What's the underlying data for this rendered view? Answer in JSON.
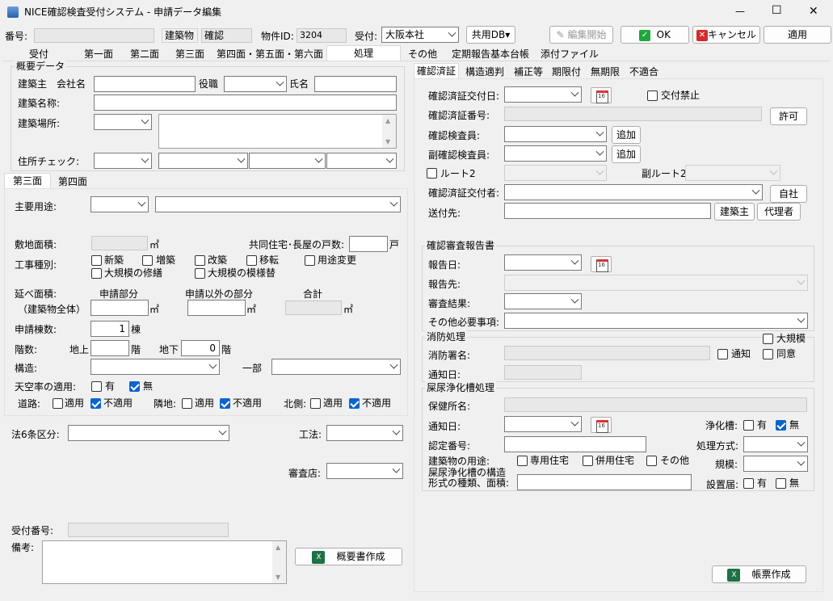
{
  "window": {
    "title": "NICE確認検査受付システム - 申請データ編集",
    "min": "—",
    "max": "☐",
    "close": "✕"
  },
  "top": {
    "bango_label": "番号:",
    "building_type": "建築物",
    "kakunin": "確認",
    "bukken_label": "物件ID:",
    "bukken_id": "3204",
    "uketsuke_label": "受付:",
    "uketsuke_value": "大阪本社",
    "kyoyodb": "共用DB▾",
    "edit_start": "編集開始",
    "ok": "OK",
    "cancel": "キャンセル",
    "apply": "適用"
  },
  "main_tabs": [
    "受付",
    "第一面",
    "第二面",
    "第三面",
    "第四面・第五面・第六面",
    "処理",
    "その他",
    "定期報告基本台帳",
    "添付ファイル"
  ],
  "gaiyo": {
    "title": "概要データ",
    "kenchikunushi": "建築主",
    "kaishamei": "会社名",
    "yakushoku": "役職",
    "shimei": "氏名",
    "kenchiku_meisho": "建築名称:",
    "kenchiku_basho": "建築場所:",
    "jusho_check": "住所チェック:"
  },
  "sub_tabs": [
    "第三面",
    "第四面"
  ],
  "daisanmen": {
    "shuyo_yoto": "主要用途:",
    "shikichi": "敷地面積:",
    "m2": "㎡",
    "kyodo": "共同住宅･長屋の戸数:",
    "ko": "戸",
    "koji_label": "工事種別:",
    "koji": [
      "新築",
      "増築",
      "改築",
      "移転",
      "用途変更",
      "大規模の修繕",
      "大規模の模様替"
    ],
    "nobe": "延べ面積:",
    "zentai": "（建築物全体）",
    "shinsei": "申請部分",
    "shinsei_igai": "申請以外の部分",
    "gokei": "合計",
    "tosu_label": "申請棟数:",
    "tosu": "1",
    "to": "棟",
    "kaisu": "階数:",
    "chijo": "地上",
    "kai": "階",
    "chika": "地下",
    "chika_val": "0",
    "kozo": "構造:",
    "ichibu": "一部",
    "tenku": "天空率の適用:",
    "ari": "有",
    "nashi": "無",
    "doro": "道路:",
    "rinchi": "隣地:",
    "kitagawa": "北側:",
    "tekiyo": "適用",
    "futekiyo": "不適用"
  },
  "lower": {
    "ho6jo": "法6条区分:",
    "koho": "工法:",
    "shinsa": "審査店:",
    "uketsuke_bango": "受付番号:",
    "biko": "備考:",
    "gaiyo_btn": "概要書作成"
  },
  "right_tabs": [
    "確認済証",
    "構造適判",
    "補正等",
    "期限付",
    "無期限",
    "不適合"
  ],
  "kakunin": {
    "kofubi": "確認済証交付日:",
    "kofu_kinshi": "交付禁止",
    "sumi_bango": "確認済証番号:",
    "kyoka": "許可",
    "kensain": "確認検査員:",
    "tsuika": "追加",
    "fuku_kensain": "副確認検査員:",
    "route2": "ルート2",
    "fuku_route2": "副ルート2",
    "kofusha": "確認済証交付者:",
    "jisha": "自社",
    "sofusaki": "送付先:",
    "kenchikunushi_btn": "建築主",
    "dairinin": "代理者"
  },
  "shinsa_hokoku": {
    "title": "確認審査報告書",
    "hokokubi": "報告日:",
    "hokokusaki": "報告先:",
    "kekka": "審査結果:",
    "sonota": "その他必要事項:"
  },
  "shobo": {
    "title": "消防処理",
    "daikibo": "大規模",
    "shobosho": "消防署名:",
    "tsuchi": "通知",
    "doi": "同意",
    "tsuchibi": "通知日:"
  },
  "johka": {
    "title": "屎尿浄化槽処理",
    "hokensho": "保健所名:",
    "tsuchibi": "通知日:",
    "johkaso": "浄化槽:",
    "ari": "有",
    "nashi": "無",
    "nintei": "認定番号:",
    "shori": "処理方式:",
    "yoto": "建築物の用途:",
    "senyo": "専用住宅",
    "heiyo": "併用住宅",
    "sonota": "その他",
    "kibo": "規模:",
    "kozo": "屎尿浄化槽の構造",
    "keishiki": "形式の種類、面積:",
    "setchi": "設置届:"
  },
  "chohyo_btn": "帳票作成",
  "colors": {
    "accent": "#0a64d0",
    "title_bg": "#f0f0f0"
  }
}
